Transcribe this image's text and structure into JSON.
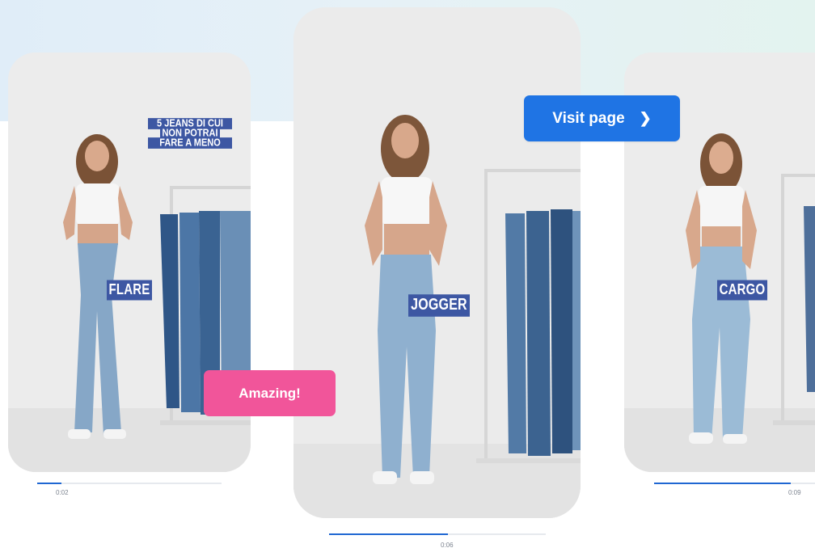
{
  "cards": [
    {
      "tag": "FLARE",
      "title_lines": [
        "5 JEANS DI CUI",
        "NON POTRAI",
        "FARE A MENO"
      ],
      "progress": 0.13,
      "time": "0:02"
    },
    {
      "tag": "JOGGER",
      "progress": 0.55,
      "time": "0:06"
    },
    {
      "tag": "CARGO",
      "progress": 0.85,
      "time": "0:09"
    }
  ],
  "buttons": {
    "visit_page": {
      "label": "Visit page",
      "icon": "chevron-right-icon"
    },
    "reaction": {
      "label": "Amazing!"
    }
  },
  "colors": {
    "visit_button": "#1f74e4",
    "reaction_button": "#f1559a",
    "tag_background": "#3d57a3",
    "progress_fill": "#1f67d2"
  }
}
